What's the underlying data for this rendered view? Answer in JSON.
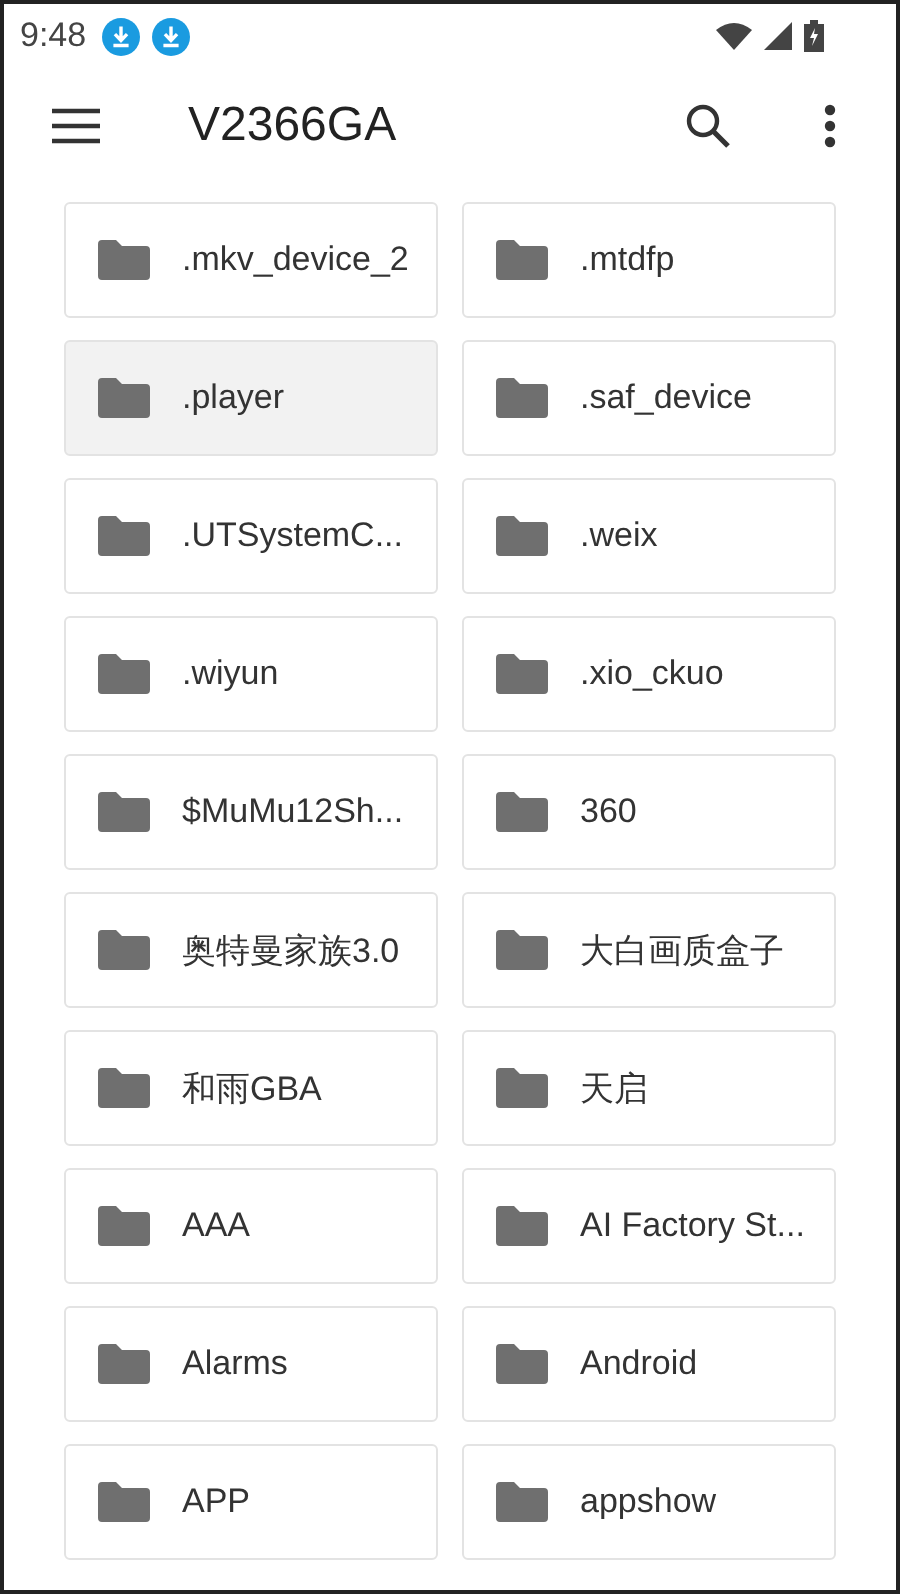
{
  "status_bar": {
    "time": "9:48",
    "notifications": [
      {
        "kind": "download"
      },
      {
        "kind": "download"
      }
    ]
  },
  "app_bar": {
    "title": "V2366GA"
  },
  "folders": [
    {
      "name": ".mkv_device_2",
      "selected": false
    },
    {
      "name": ".mtdfp",
      "selected": false
    },
    {
      "name": ".player",
      "selected": true
    },
    {
      "name": ".saf_device",
      "selected": false
    },
    {
      "name": ".UTSystemC...",
      "selected": false
    },
    {
      "name": ".weix",
      "selected": false
    },
    {
      "name": ".wiyun",
      "selected": false
    },
    {
      "name": ".xio_ckuo",
      "selected": false
    },
    {
      "name": "$MuMu12Sh...",
      "selected": false
    },
    {
      "name": "360",
      "selected": false
    },
    {
      "name": "奥特曼家族3.0",
      "selected": false
    },
    {
      "name": "大白画质盒子",
      "selected": false
    },
    {
      "name": "和雨GBA",
      "selected": false
    },
    {
      "name": "天启",
      "selected": false
    },
    {
      "name": "AAA",
      "selected": false
    },
    {
      "name": "AI Factory St...",
      "selected": false
    },
    {
      "name": "Alarms",
      "selected": false
    },
    {
      "name": "Android",
      "selected": false
    },
    {
      "name": "APP",
      "selected": false
    },
    {
      "name": "appshow",
      "selected": false
    }
  ]
}
